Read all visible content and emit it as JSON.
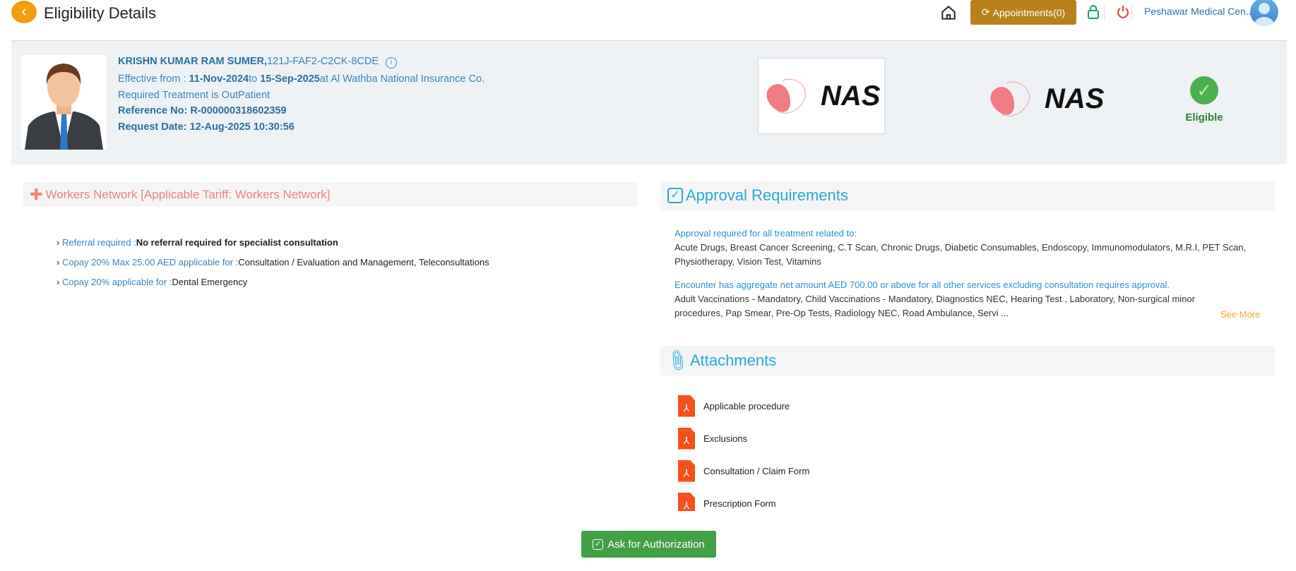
{
  "header": {
    "title": "Eligibility Details",
    "appointments_label": "Appointments(0)",
    "facility": "Peshawar Medical Cen..."
  },
  "patient": {
    "name": "KRISHN KUMAR RAM SUMER,",
    "id": "121J-FAF2-C2CK-8CDE",
    "effective_label": "Effective from : ",
    "from": "11-Nov-2024",
    "to_label": "to ",
    "to": "15-Sep-2025",
    "insurer": "at Al Wathba National Insurance Co.",
    "treatment": "Required Treatment is OutPatient",
    "reference": "Reference No: R-000000318602359",
    "request_date": "Request Date: 12-Aug-2025 10:30:56"
  },
  "payer": {
    "logo_text": "NAS",
    "status": "Eligible"
  },
  "network": {
    "title": "Workers Network [Applicable Tariff: Workers Network]",
    "items": [
      {
        "key": "Referral required :",
        "value": "No referral required for specialist consultation"
      },
      {
        "key": "Copay 20% Max 25.00 AED applicable for :",
        "value": "Consultation / Evaluation and Management, Teleconsultations"
      },
      {
        "key": "Copay 20% applicable for :",
        "value": "Dental Emergency"
      }
    ]
  },
  "approval": {
    "title": "Approval Requirements",
    "heading1": "Approval required for all treatment related to:",
    "list1": "Acute Drugs, Breast Cancer Screening, C.T Scan, Chronic Drugs, Diabetic Consumables, Endoscopy, Immunomodulators, M.R.I, PET Scan, Physiotherapy, Vision Test, Vitamins",
    "heading2": "Encounter has aggregate net amount AED 700.00 or above for all other services excluding consultation requires approval.",
    "list2": "Adult Vaccinations - Mandatory, Child Vaccinations - Mandatory, Diagnostics NEC, Hearing Test , Laboratory, Non-surgical minor procedures, Pap Smear, Pre-Op Tests, Radiology NEC, Road Ambulance, Servi ...",
    "see_more": "See More"
  },
  "attachments": {
    "title": "Attachments",
    "items": [
      "Applicable procedure",
      "Exclusions",
      "Consultation / Claim Form",
      "Prescription Form"
    ]
  },
  "actions": {
    "authorize": "Ask for Authorization"
  },
  "colors": {
    "accent": "#29a8e0",
    "eligible": "#4caf50",
    "appointments": "#b8811a"
  }
}
